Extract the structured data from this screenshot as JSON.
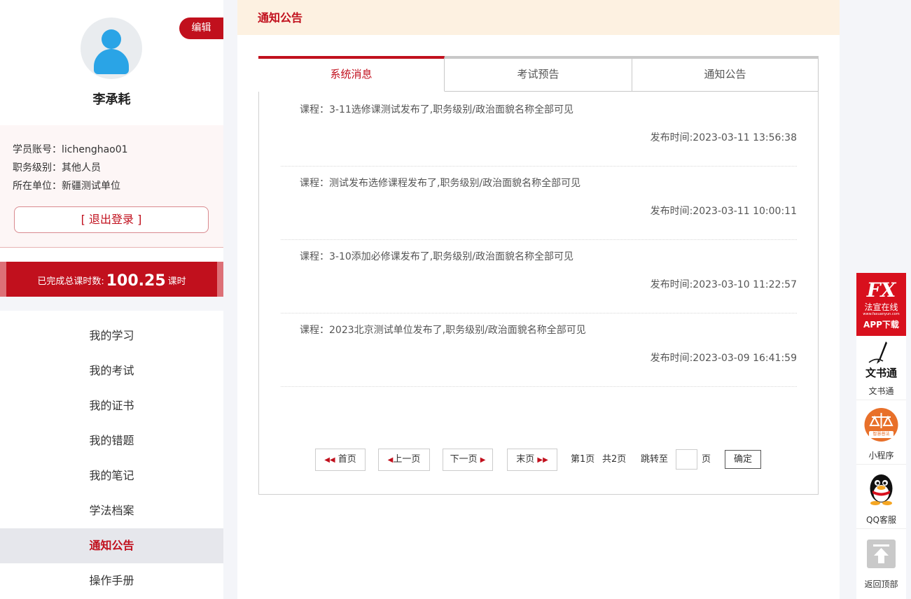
{
  "user": {
    "name": "李承耗",
    "edit_label": "编辑",
    "account_line": "学员账号：lichenghao01",
    "level_line": "职务级别：其他人员",
    "unit_line": "所在单位：新疆测试单位",
    "logout_label": "[ 退出登录 ]"
  },
  "hours": {
    "label": "已完成总课时数:",
    "value": "100.25",
    "unit": "课时"
  },
  "menu": [
    {
      "label": "我的学习"
    },
    {
      "label": "我的考试"
    },
    {
      "label": "我的证书"
    },
    {
      "label": "我的错题"
    },
    {
      "label": "我的笔记"
    },
    {
      "label": "学法档案"
    },
    {
      "label": "通知公告",
      "active": true
    },
    {
      "label": "操作手册"
    }
  ],
  "page": {
    "title": "通知公告"
  },
  "tabs": [
    {
      "label": "系统消息",
      "active": true
    },
    {
      "label": "考试预告"
    },
    {
      "label": "通知公告"
    }
  ],
  "notices": [
    {
      "text": "课程：3-11选修课测试发布了,职务级别/政治面貌名称全部可见",
      "time": "发布时间:2023-03-11 13:56:38"
    },
    {
      "text": "课程：测试发布选修课程发布了,职务级别/政治面貌名称全部可见",
      "time": "发布时间:2023-03-11 10:00:11"
    },
    {
      "text": "课程：3-10添加必修课发布了,职务级别/政治面貌名称全部可见",
      "time": "发布时间:2023-03-10 11:22:57"
    },
    {
      "text": "课程：2023北京测试单位发布了,职务级别/政治面貌名称全部可见",
      "time": "发布时间:2023-03-09 16:41:59"
    }
  ],
  "pagination": {
    "first": "首页",
    "prev": "上一页",
    "next": "下一页",
    "last": "末页",
    "current": "第1页",
    "total": "共2页",
    "jump_label": "跳转至",
    "page_unit": "页",
    "confirm": "确定"
  },
  "right_bar": {
    "app_logo": "FX",
    "app_name": "法宣在线",
    "app_url": "www.faxuanyun.com",
    "app_download": "APP下载",
    "wenshu": "文书通",
    "wenshu_label": "文书通",
    "mini_badge": "智慧普法",
    "mini_label": "小程序",
    "qq_label": "QQ客服",
    "top_label": "返回顶部"
  },
  "colors": {
    "accent": "#c1101d",
    "header_bg": "#fdf1e1"
  }
}
